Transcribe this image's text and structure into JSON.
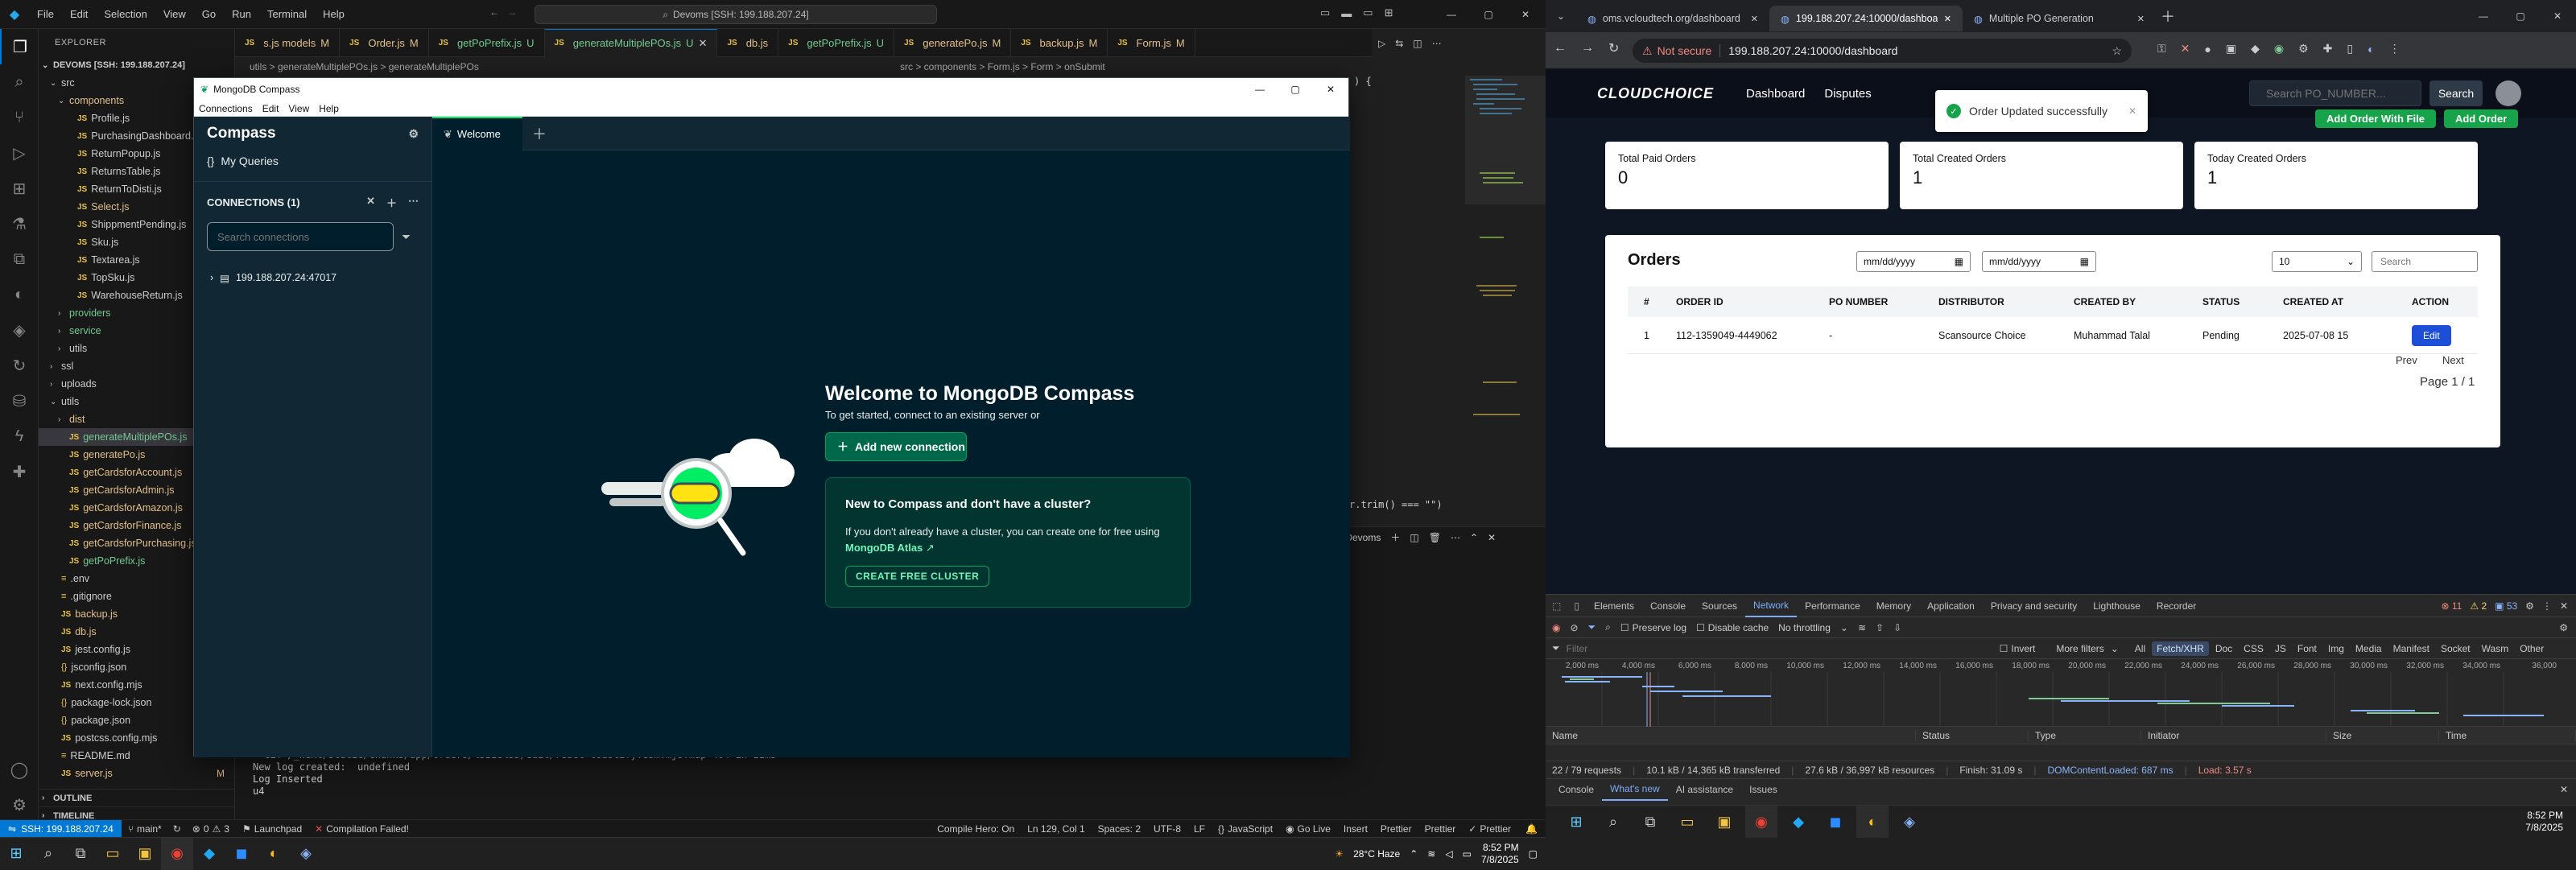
{
  "vscode": {
    "menus": [
      "File",
      "Edit",
      "Selection",
      "View",
      "Go",
      "Run",
      "Terminal",
      "Help"
    ],
    "command_center": "Devoms [SSH: 199.188.207.24]",
    "explorer_title": "EXPLORER",
    "root": "DEVOMS [SSH: 199.188.207.24]",
    "tree": [
      {
        "label": "src",
        "kind": "folder",
        "indent": 1,
        "open": true
      },
      {
        "label": "components",
        "kind": "folder",
        "indent": 2,
        "open": true,
        "color": "#e2c08d"
      },
      {
        "label": "Profile.js",
        "kind": "js",
        "indent": 3
      },
      {
        "label": "PurchasingDashboard.js",
        "kind": "js",
        "indent": 3
      },
      {
        "label": "ReturnPopup.js",
        "kind": "js",
        "indent": 3
      },
      {
        "label": "ReturnsTable.js",
        "kind": "js",
        "indent": 3
      },
      {
        "label": "ReturnToDisti.js",
        "kind": "js",
        "indent": 3
      },
      {
        "label": "Select.js",
        "kind": "js",
        "indent": 3,
        "mark": "M",
        "color": "#e2c08d"
      },
      {
        "label": "ShippmentPending.js",
        "kind": "js",
        "indent": 3
      },
      {
        "label": "Sku.js",
        "kind": "js",
        "indent": 3
      },
      {
        "label": "Textarea.js",
        "kind": "js",
        "indent": 3
      },
      {
        "label": "TopSku.js",
        "kind": "js",
        "indent": 3
      },
      {
        "label": "WarehouseReturn.js",
        "kind": "js",
        "indent": 3
      },
      {
        "label": "providers",
        "kind": "folder",
        "indent": 2,
        "open": false,
        "color": "#73c991"
      },
      {
        "label": "service",
        "kind": "folder",
        "indent": 2,
        "open": false,
        "color": "#73c991"
      },
      {
        "label": "utils",
        "kind": "folder",
        "indent": 2,
        "open": false
      },
      {
        "label": "ssl",
        "kind": "folder",
        "indent": 1,
        "open": false
      },
      {
        "label": "uploads",
        "kind": "folder",
        "indent": 1,
        "open": false
      },
      {
        "label": "utils",
        "kind": "folder",
        "indent": 1,
        "open": true
      },
      {
        "label": "dist",
        "kind": "folder",
        "indent": 2,
        "open": false,
        "color": "#e2c08d"
      },
      {
        "label": "generateMultiplePOs.js",
        "kind": "js",
        "indent": 2,
        "mark": "U",
        "color": "#73c991",
        "selected": true
      },
      {
        "label": "generatePo.js",
        "kind": "js",
        "indent": 2,
        "color": "#e2c08d"
      },
      {
        "label": "getCardsforAccount.js",
        "kind": "js",
        "indent": 2,
        "color": "#e2c08d"
      },
      {
        "label": "getCardsforAdmin.js",
        "kind": "js",
        "indent": 2,
        "color": "#e2c08d"
      },
      {
        "label": "getCardsforAmazon.js",
        "kind": "js",
        "indent": 2,
        "color": "#e2c08d"
      },
      {
        "label": "getCardsforFinance.js",
        "kind": "js",
        "indent": 2,
        "color": "#e2c08d"
      },
      {
        "label": "getCardsforPurchasing.js",
        "kind": "js",
        "indent": 2,
        "color": "#e2c08d"
      },
      {
        "label": "getPoPrefix.js",
        "kind": "js",
        "indent": 2,
        "color": "#73c991"
      },
      {
        "label": ".env",
        "kind": "env",
        "indent": 1
      },
      {
        "label": ".gitignore",
        "kind": "env",
        "indent": 1
      },
      {
        "label": "backup.js",
        "kind": "js",
        "indent": 1,
        "color": "#e2c08d"
      },
      {
        "label": "db.js",
        "kind": "js",
        "indent": 1,
        "color": "#e2c08d"
      },
      {
        "label": "jest.config.js",
        "kind": "js",
        "indent": 1
      },
      {
        "label": "jsconfig.json",
        "kind": "json",
        "indent": 1
      },
      {
        "label": "next.config.mjs",
        "kind": "js",
        "indent": 1
      },
      {
        "label": "package-lock.json",
        "kind": "json",
        "indent": 1
      },
      {
        "label": "package.json",
        "kind": "json",
        "indent": 1
      },
      {
        "label": "postcss.config.mjs",
        "kind": "js",
        "indent": 1
      },
      {
        "label": "README.md",
        "kind": "env",
        "indent": 1
      },
      {
        "label": "server.js",
        "kind": "js",
        "indent": 1,
        "mark": "M",
        "color": "#e2c08d"
      }
    ],
    "outline": "OUTLINE",
    "timeline": "TIMELINE",
    "tabs": [
      {
        "label": "s.js models",
        "mark": "M",
        "color": "#e2c08d"
      },
      {
        "label": "Order.js",
        "mark": "M",
        "color": "#e2c08d"
      },
      {
        "label": "getPoPrefix.js",
        "mark": "U",
        "color": "#73c991"
      },
      {
        "label": "generateMultiplePOs.js",
        "mark": "U",
        "color": "#73c991",
        "active": true
      },
      {
        "label": "db.js",
        "mark": "",
        "color": "#e2c08d"
      },
      {
        "label": "getPoPrefix.js",
        "mark": "U",
        "color": "#73c991"
      },
      {
        "label": "generatePo.js",
        "mark": "M",
        "color": "#e2c08d"
      },
      {
        "label": "backup.js",
        "mark": "M",
        "color": "#e2c08d"
      },
      {
        "label": "Form.js",
        "mark": "M",
        "color": "#e2c08d"
      }
    ],
    "breadcrumb_left": "utils > generateMultiplePOs.js > generateMultiplePOs",
    "breadcrumb_right": "src > components > Form.js > Form > onSubmit",
    "code_snippet_1": ") {",
    "code_snippet_2": "r.trim() === \"\")",
    "terminal_label": "pm - Devoms",
    "terminal_lines": [
      "  GET /_next/static/chunks/app/orders/%5BId%5D/edit/react-toastify.esm.mjs.map 404 in 11ms",
      "New log created:  undefined",
      "Log Inserted",
      "u4"
    ],
    "status": {
      "remote": "SSH: 199.188.207.24",
      "branch": "main*",
      "errors": "0",
      "warnings": "3",
      "launchpad": "Launchpad",
      "compile_failed": "Compilation Failed!",
      "compile_hero": "Compile Hero: On",
      "cursor": "Ln 129, Col 1",
      "spaces": "Spaces: 2",
      "encoding": "UTF-8",
      "eol": "LF",
      "lang": "JavaScript",
      "golive": "Go Live",
      "insert": "Insert",
      "prettier1": "Prettier",
      "prettier2": "Prettier",
      "prettier3": "Prettier"
    }
  },
  "compass": {
    "window_title": "MongoDB Compass",
    "menus": [
      "Connections",
      "Edit",
      "View",
      "Help"
    ],
    "brand": "Compass",
    "my_queries": "My Queries",
    "connections_header": "CONNECTIONS (1)",
    "search_placeholder": "Search connections",
    "connection": "199.188.207.24:47017",
    "tab_welcome": "Welcome",
    "welcome_title": "Welcome to MongoDB Compass",
    "welcome_sub": "To get started, connect to an existing server or",
    "add_connection": "Add new connection",
    "cluster_title": "New to Compass and don't have a cluster?",
    "cluster_text": "If you don't already have a cluster, you can create one for free using",
    "atlas_link": "MongoDB Atlas",
    "create_cluster": "CREATE FREE CLUSTER"
  },
  "chrome": {
    "tabs": [
      {
        "label": "oms.vcloudtech.org/dashboard"
      },
      {
        "label": "199.188.207.24:10000/dashboa",
        "active": true
      },
      {
        "label": "Multiple PO Generation"
      }
    ],
    "not_secure": "Not secure",
    "url": "199.188.207.24:10000/dashboard",
    "app": {
      "logo": "CLOUDCHOICE",
      "nav": [
        "Dashboard",
        "Disputes"
      ],
      "toast": "Order Updated successfully",
      "search_placeholder": "Search PO_NUMBER...",
      "search_button": "Search",
      "btn_upload": "Add Order With File",
      "btn_add": "Add Order",
      "cards": [
        {
          "label": "Total Paid Orders",
          "value": "0"
        },
        {
          "label": "Total Created Orders",
          "value": "1"
        },
        {
          "label": "Today Created Orders",
          "value": "1"
        }
      ],
      "orders_title": "Orders",
      "date_placeholder": "mm/dd/yyyy",
      "page_size": "10",
      "table_search_placeholder": "Search",
      "columns": [
        "#",
        "ORDER ID",
        "PO NUMBER",
        "DISTRIBUTOR",
        "CREATED BY",
        "STATUS",
        "CREATED AT",
        "ACTION"
      ],
      "rows": [
        [
          "1",
          "112-1359049-4449062",
          "-",
          "Scansource Choice",
          "Muhammad Talal",
          "Pending",
          "2025-07-08 15",
          "Edit"
        ]
      ],
      "prev": "Prev",
      "next": "Next",
      "page_info": "Page 1 / 1"
    },
    "devtools": {
      "tabs": [
        "Elements",
        "Console",
        "Sources",
        "Network",
        "Performance",
        "Memory",
        "Application",
        "Privacy and security",
        "Lighthouse",
        "Recorder"
      ],
      "active_tab": "Network",
      "errors": "11",
      "warnings": "2",
      "issues": "53",
      "preserve_log": "Preserve log",
      "disable_cache": "Disable cache",
      "throttling": "No throttling",
      "filter_placeholder": "Filter",
      "invert": "Invert",
      "more_filters": "More filters",
      "types": [
        "All",
        "Fetch/XHR",
        "Doc",
        "CSS",
        "JS",
        "Font",
        "Img",
        "Media",
        "Manifest",
        "Socket",
        "Wasm",
        "Other"
      ],
      "active_type": "Fetch/XHR",
      "timeline_ticks": [
        "2,000 ms",
        "4,000 ms",
        "6,000 ms",
        "8,000 ms",
        "10,000 ms",
        "12,000 ms",
        "14,000 ms",
        "16,000 ms",
        "18,000 ms",
        "20,000 ms",
        "22,000 ms",
        "24,000 ms",
        "26,000 ms",
        "28,000 ms",
        "30,000 ms",
        "32,000 ms",
        "34,000 ms",
        "36,000"
      ],
      "columns": [
        "Name",
        "Status",
        "Type",
        "Initiator",
        "Size",
        "Time"
      ],
      "summary": {
        "requests": "22 / 79 requests",
        "transferred": "10.1 kB / 14,365 kB transferred",
        "resources": "27.6 kB / 36,997 kB resources",
        "finish": "Finish: 31.09 s",
        "dcl": "DOMContentLoaded: 687 ms",
        "load": "Load: 3.57 s"
      },
      "drawer_tabs": [
        "Console",
        "What's new",
        "AI assistance",
        "Issues"
      ],
      "active_drawer": "What's new"
    }
  },
  "taskbar_left": {
    "weather": "28°C  Haze",
    "time": "8:52 PM",
    "date": "7/8/2025"
  },
  "taskbar_right": {
    "time": "8:52 PM",
    "date": "7/8/2025"
  }
}
